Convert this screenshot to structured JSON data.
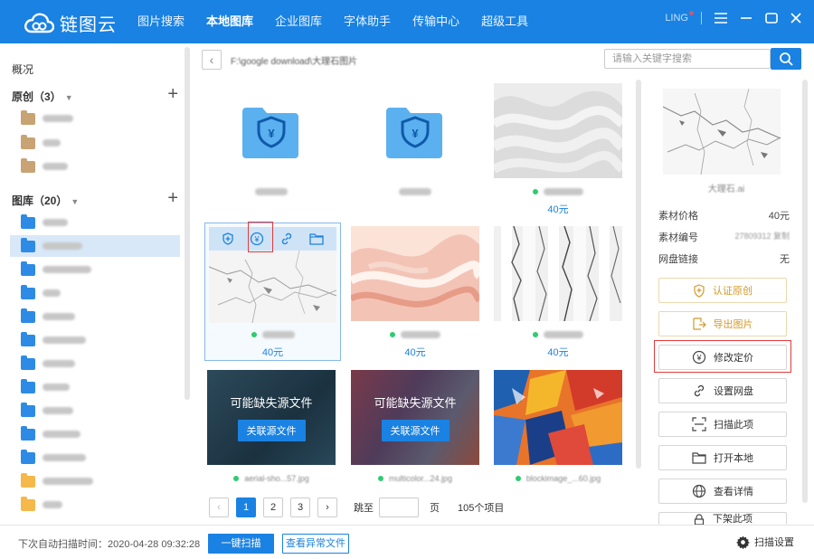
{
  "app": {
    "title": "链图云"
  },
  "nav": [
    {
      "label": "图片搜索"
    },
    {
      "label": "本地图库",
      "active": true
    },
    {
      "label": "企业图库"
    },
    {
      "label": "字体助手"
    },
    {
      "label": "传输中心"
    },
    {
      "label": "超级工具"
    }
  ],
  "user": {
    "name": "LING"
  },
  "sidebar": {
    "overview": "概况",
    "original_group": "原创（3）",
    "gallery_group": "图库（20）"
  },
  "main": {
    "path": "F:\\google download\\大理石图片",
    "search_placeholder": "请输入关键字搜索"
  },
  "cards": [
    {
      "name": "大理石",
      "type": "folder"
    },
    {
      "name": "建材类",
      "type": "folder"
    },
    {
      "name": "2548458.ai",
      "price": "40元",
      "status": "ok"
    },
    {
      "name": "大理石.ai",
      "price": "40元",
      "status": "ok",
      "selected": true
    },
    {
      "name": "大理石14.ai",
      "price": "40元",
      "status": "ok"
    },
    {
      "name": "大理石15.ai",
      "price": "40元",
      "status": "ok"
    },
    {
      "name": "aerial-sho...57.jpg",
      "missing": "可能缺失源文件",
      "link": "关联源文件",
      "status": "ok"
    },
    {
      "name": "multicolor...24.jpg",
      "missing": "可能缺失源文件",
      "link": "关联源文件",
      "status": "ok"
    },
    {
      "name": "blockimage_...60.jpg",
      "status": "ok"
    }
  ],
  "pager": {
    "pages": [
      "1",
      "2",
      "3"
    ],
    "current": "1",
    "prev": "‹",
    "next": "›",
    "jump_label": "跳至",
    "page_unit": "页",
    "total": "105个项目"
  },
  "detail": {
    "filename": "大理石.ai",
    "props": [
      {
        "label": "素材价格",
        "value": "40元"
      },
      {
        "label": "素材编号",
        "value": "27809312 复制"
      },
      {
        "label": "网盘链接",
        "value": "无"
      }
    ],
    "actions": [
      {
        "label": "认证原创",
        "icon": "shield-plus-icon"
      },
      {
        "label": "导出图片",
        "icon": "export-icon"
      },
      {
        "label": "修改定价",
        "icon": "yen-icon"
      },
      {
        "label": "设置网盘",
        "icon": "link-icon"
      },
      {
        "label": "扫描此项",
        "icon": "scan-icon"
      },
      {
        "label": "打开本地",
        "icon": "folder-icon"
      },
      {
        "label": "查看详情",
        "icon": "globe-icon"
      },
      {
        "label": "下架此项",
        "icon": "lock-icon"
      }
    ]
  },
  "bottom": {
    "next_scan": "下次自动扫描时间：2020-04-28 09:32:28",
    "scan_btn": "一键扫描",
    "errors_btn": "查看异常文件",
    "settings": "扫描设置"
  },
  "colors": {
    "accent": "#1a82e2",
    "highlight": "#e23b3b",
    "price": "#1a82e2"
  }
}
